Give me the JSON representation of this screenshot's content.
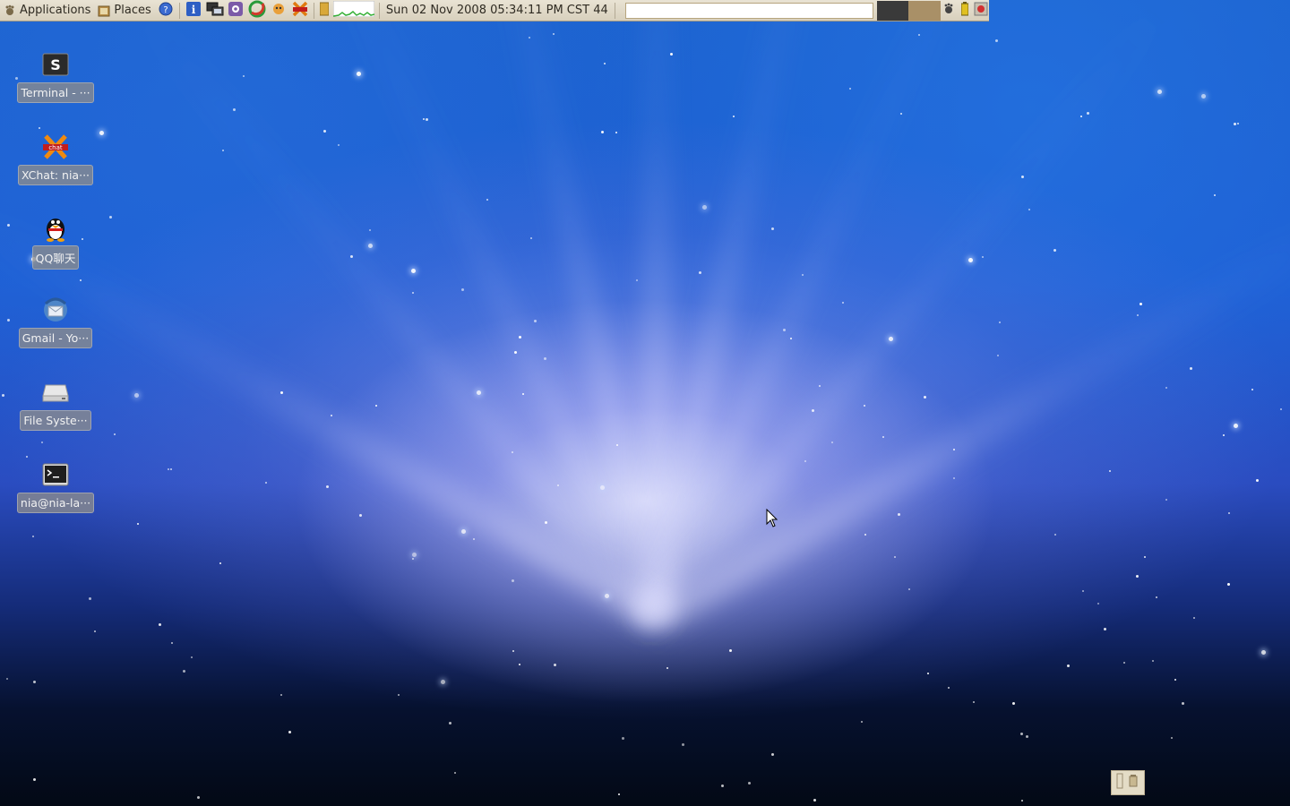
{
  "panel": {
    "applications_label": "Applications",
    "places_label": "Places",
    "clock_text": "Sun 02 Nov 2008 05:34:11 PM CST 44",
    "search_value": "",
    "launchers": [
      "info-icon",
      "network-icon",
      "settings-icon",
      "browser-icon",
      "qq-icon",
      "xchat-icon"
    ]
  },
  "desktop": {
    "icons": [
      {
        "label": "Terminal - ···",
        "icon": "terminal-s-icon"
      },
      {
        "label": "XChat: nia···",
        "icon": "xchat-icon"
      },
      {
        "label": "QQ聊天",
        "icon": "qq-penguin-icon"
      },
      {
        "label": "Gmail - Yo···",
        "icon": "thunderbird-icon"
      },
      {
        "label": "File Syste···",
        "icon": "drive-icon"
      },
      {
        "label": "nia@nia-la···",
        "icon": "terminal-icon"
      }
    ]
  },
  "colors": {
    "panel_bg": "#e0d9c7",
    "wallpaper_main": "#1d5ed4",
    "label_bg": "#8c8c8c"
  }
}
